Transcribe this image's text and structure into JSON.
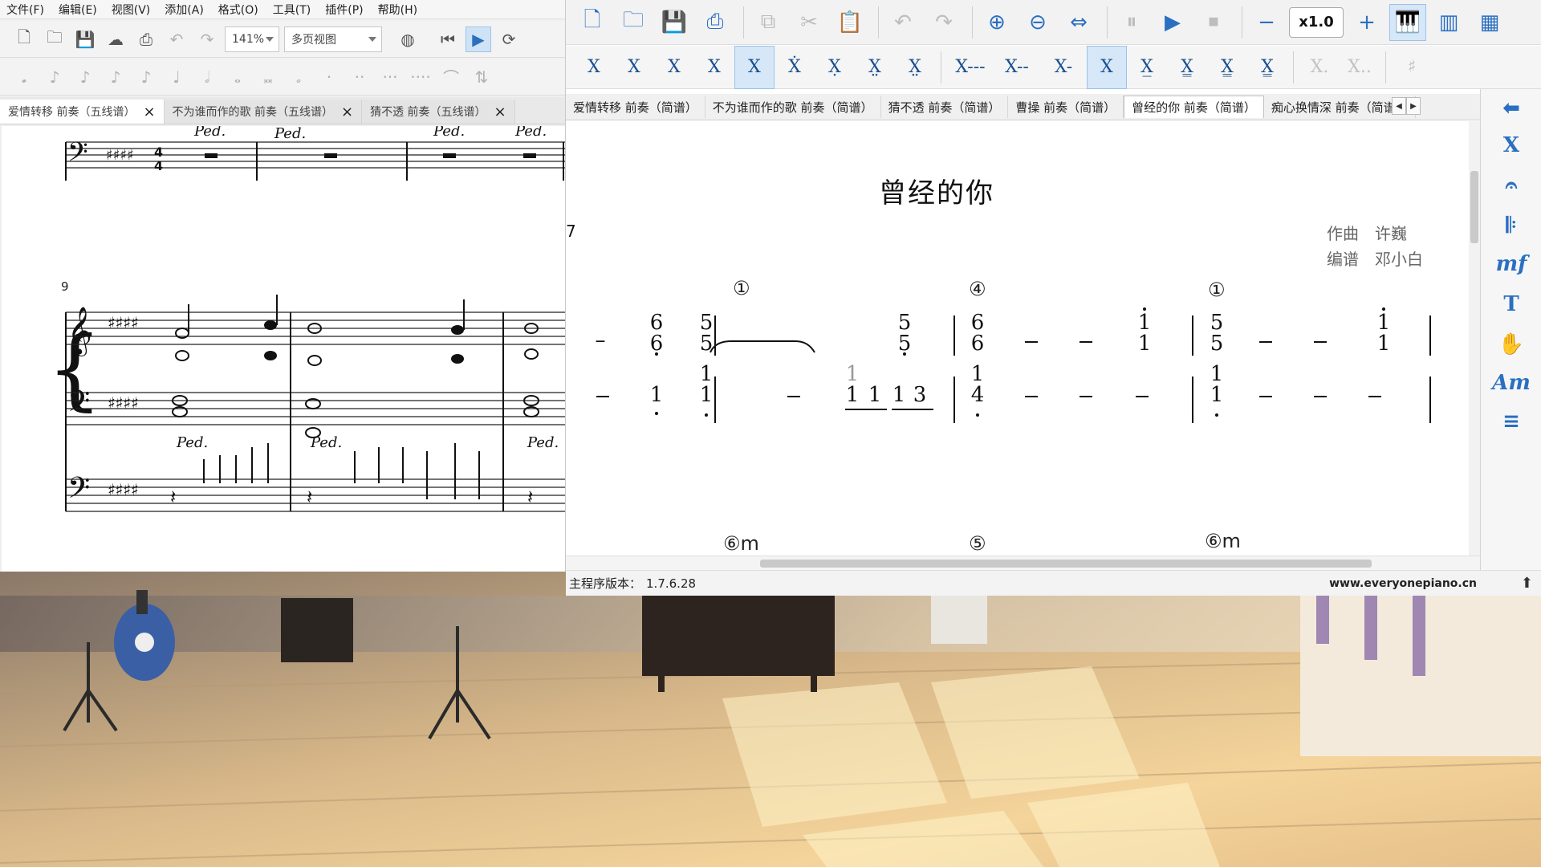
{
  "left_window": {
    "menu": [
      "文件(F)",
      "编辑(E)",
      "视图(V)",
      "添加(A)",
      "格式(O)",
      "工具(T)",
      "插件(P)",
      "帮助(H)"
    ],
    "zoom": "141%",
    "view_mode": "多页视图",
    "tabs": [
      {
        "label": "爱情转移 前奏（五线谱）"
      },
      {
        "label": "不为谁而作的歌 前奏（五线谱）"
      },
      {
        "label": "猜不透 前奏（五线谱）"
      }
    ],
    "measure_number": "9",
    "pedal_mark": "Ped."
  },
  "right_window": {
    "speed": "x1.0",
    "tabs": [
      {
        "label": "爱情转移 前奏（简谱）"
      },
      {
        "label": "不为谁而作的歌 前奏（简谱）"
      },
      {
        "label": "猜不透 前奏（简谱）"
      },
      {
        "label": "曹操 前奏（简谱）"
      },
      {
        "label": "曾经的你 前奏（简谱）"
      },
      {
        "label": "痴心换情深 前奏（简谱）"
      }
    ],
    "score": {
      "title": "曾经的你",
      "composer_label": "作曲",
      "composer": "许巍",
      "arranger_label": "编谱",
      "arranger": "邓小白",
      "measure_start": "7",
      "chord_markers": [
        "①",
        "④",
        "①"
      ],
      "bass_markers": [
        "⑥m",
        "⑤",
        "⑥m"
      ],
      "notes": {
        "dash": "–",
        "one": "1",
        "three": "3",
        "four": "4",
        "five": "5",
        "six": "6"
      }
    },
    "status": {
      "version_label": "主程序版本：",
      "version": "1.7.6.28",
      "website": "www.everyonepiano.cn"
    },
    "side_panel": [
      "⬅",
      "X",
      "𝄐",
      "𝄆",
      "mf",
      "T",
      "✋",
      "Am",
      "≡"
    ]
  }
}
